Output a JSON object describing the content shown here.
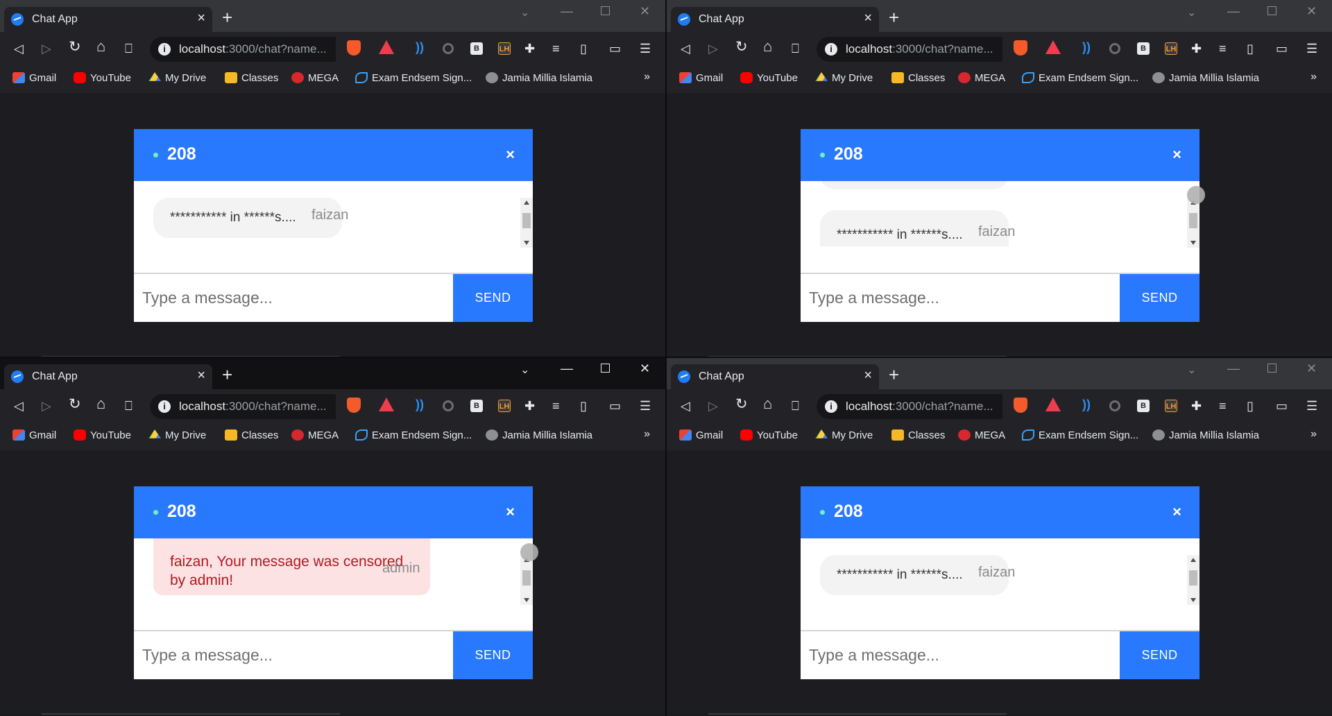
{
  "browser": {
    "tab_title": "Chat App",
    "tab_close": "×",
    "new_tab": "+",
    "win_chevron": "⌄",
    "win_minimize": "—",
    "win_close": "✕",
    "url_host": "localhost",
    "url_rest": ":3000/chat?name...",
    "nav": {
      "back": "◁",
      "forward": "▷",
      "reload": "↻",
      "home": "⌂",
      "bookmark": "⎕"
    },
    "bookmarks": [
      {
        "label": "Gmail",
        "icon": "gmail-icon"
      },
      {
        "label": "YouTube",
        "icon": "youtube-icon"
      },
      {
        "label": "My Drive",
        "icon": "drive-icon"
      },
      {
        "label": "Classes",
        "icon": "classes-icon"
      },
      {
        "label": "MEGA",
        "icon": "mega-icon"
      },
      {
        "label": "Exam Endsem Sign...",
        "icon": "exam-icon"
      },
      {
        "label": "Jamia Millia Islamia",
        "icon": "globe-icon"
      }
    ],
    "bookmarks_more": "»",
    "ext_b": "B",
    "ext_lh": "LH"
  },
  "chat": {
    "room": "208",
    "close": "×",
    "placeholder": "Type a message...",
    "send_label": "SEND"
  },
  "panes": [
    {
      "message": "*********** in ******s....",
      "sender": "faizan",
      "censored": false
    },
    {
      "message": "*********** in ******s....",
      "sender": "faizan",
      "censored": false
    },
    {
      "message": "faizan, Your message was censored by admin!",
      "sender": "admin",
      "censored": true
    },
    {
      "message": "*********** in ******s....",
      "sender": "faizan",
      "censored": false
    }
  ],
  "colors": {
    "accent": "#2979ff",
    "censored_bg": "#fde2e4",
    "censored_text": "#b3191f",
    "online_dot": "#6ef0c0"
  }
}
